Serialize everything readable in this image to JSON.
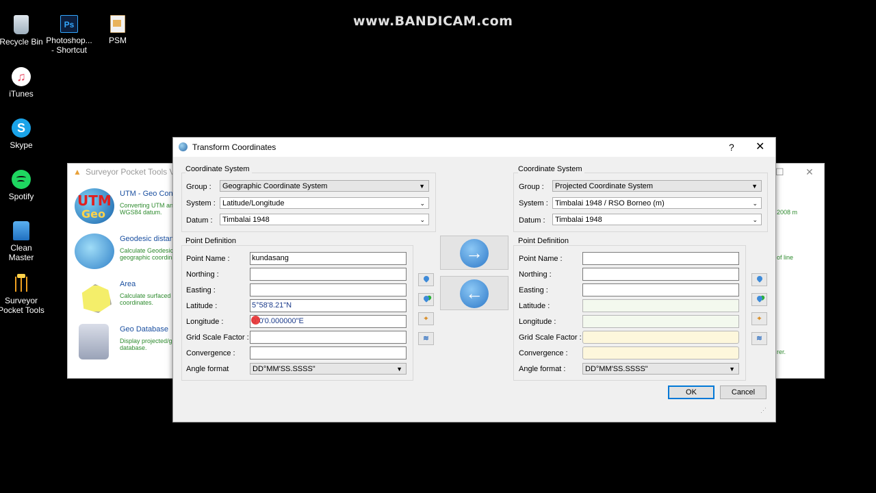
{
  "watermark": "www.BANDICAM.com",
  "desktop": {
    "icons": [
      {
        "label1": "Recycle Bin",
        "label2": ""
      },
      {
        "label1": "Photoshop...",
        "label2": "- Shortcut",
        "glyph": "Ps"
      },
      {
        "label1": "PSM",
        "label2": ""
      },
      {
        "label1": "iTunes",
        "label2": "",
        "glyph": "♫"
      },
      {
        "label1": "Skype",
        "label2": "",
        "glyph": "S"
      },
      {
        "label1": "Spotify",
        "label2": ""
      },
      {
        "label1": "Clean Master",
        "label2": ""
      },
      {
        "label1": "Surveyor",
        "label2": "Pocket Tools"
      }
    ]
  },
  "bg_window": {
    "title": "Surveyor Pocket Tools V0",
    "tools": [
      {
        "name": "UTM - Geo Conve",
        "desc": "Converting UTM an WGS84 datum.",
        "img1": "UTM",
        "img2": "Geo"
      },
      {
        "name": "Geodesic distanc",
        "desc": "Calculate Geodesic geographic coordina"
      },
      {
        "name": "Area",
        "desc": "Calculate surfaced a coordinates."
      },
      {
        "name": "Geo Database",
        "desc": "Display projected/g database."
      }
    ],
    "side_texts": [
      "2008 m",
      "of line",
      "rer."
    ]
  },
  "dialog": {
    "title": "Transform Coordinates",
    "help": "?",
    "close": "✕",
    "left": {
      "cs_title": "Coordinate System",
      "group_label": "Group :",
      "group_value": "Geographic Coordinate System",
      "system_label": "System :",
      "system_value": "Latitude/Longitude",
      "datum_label": "Datum :",
      "datum_value": "Timbalai 1948",
      "pd_title": "Point Definition",
      "point_name_label": "Point Name :",
      "point_name_value": "kundasang",
      "northing_label": "Northing :",
      "northing_value": "",
      "easting_label": "Easting :",
      "easting_value": "",
      "latitude_label": "Latitude :",
      "latitude_value": "5°58'8.21\"N",
      "longitude_label": "Longitude :",
      "longitude_value": "0°0'0.000000\"E",
      "gsf_label": "Grid Scale Factor :",
      "gsf_value": "",
      "convergence_label": "Convergence :",
      "convergence_value": "",
      "angle_label": "Angle format",
      "angle_value": "DD°MM'SS.SSSS\""
    },
    "right": {
      "cs_title": "Coordinate System",
      "group_label": "Group :",
      "group_value": "Projected Coordinate System",
      "system_label": "System :",
      "system_value": "Timbalai 1948 / RSO Borneo (m)",
      "datum_label": "Datum :",
      "datum_value": "Timbalai 1948",
      "pd_title": "Point Definition",
      "point_name_label": "Point Name :",
      "point_name_value": "",
      "northing_label": "Northing :",
      "northing_value": "",
      "easting_label": "Easting :",
      "easting_value": "",
      "latitude_label": "Latitude :",
      "latitude_value": "",
      "longitude_label": "Longitude :",
      "longitude_value": "",
      "gsf_label": "Grid Scale Factor :",
      "gsf_value": "",
      "convergence_label": "Convergence :",
      "convergence_value": "",
      "angle_label": "Angle format :",
      "angle_value": "DD°MM'SS.SSSS\""
    },
    "arrows": {
      "forward": "→",
      "back": "←"
    },
    "ok_label": "OK",
    "cancel_label": "Cancel"
  }
}
